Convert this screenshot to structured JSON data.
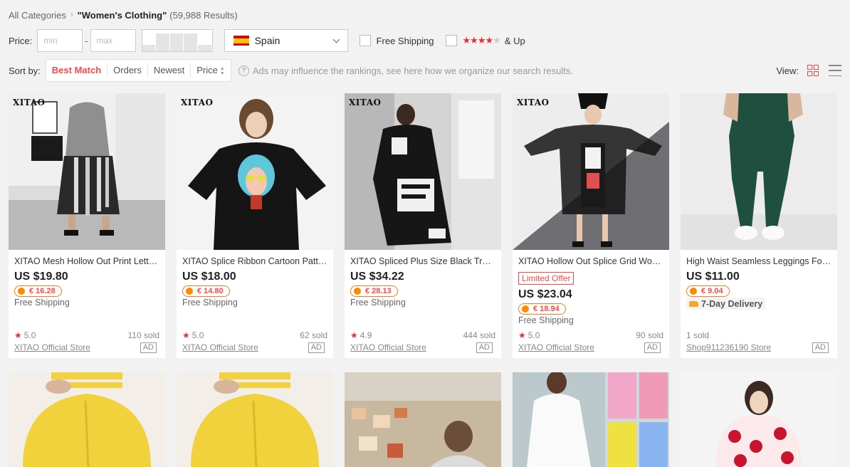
{
  "breadcrumb": {
    "root": "All Categories",
    "separator": "›",
    "query": "\"Women's Clothing\"",
    "count": "(59,988 Results)"
  },
  "filters": {
    "price_label": "Price:",
    "min_placeholder": "min",
    "max_placeholder": "max",
    "dash": "-",
    "country": "Spain",
    "free_shipping_label": "Free Shipping",
    "rating_stars": "★★★★",
    "rating_star_dim": "★",
    "rating_suffix": "& Up"
  },
  "sortbar": {
    "label": "Sort by:",
    "options": [
      "Best Match",
      "Orders",
      "Newest",
      "Price"
    ],
    "active": "Best Match",
    "ads_note": "Ads may influence the rankings, see here how we organize our search results.",
    "view_label": "View:"
  },
  "products": [
    {
      "brand": "XITAO",
      "title": "XITAO Mesh Hollow Out Print Letter Casual Dress",
      "price": "US $19.80",
      "coin_price": "€ 16.28",
      "shipping": "Free Shipping",
      "rating": "5.0",
      "sold": "110 sold",
      "store": "XITAO Official Store",
      "ad": "AD"
    },
    {
      "brand": "XITAO",
      "title": "XITAO Splice Ribbon Cartoon Pattern T-shirt Dress",
      "price": "US $18.00",
      "coin_price": "€ 14.80",
      "shipping": "Free Shipping",
      "rating": "5.0",
      "sold": "62 sold",
      "store": "XITAO Official Store",
      "ad": "AD"
    },
    {
      "brand": "XITAO",
      "title": "XITAO Spliced Plus Size Black Trench Coat",
      "price": "US $34.22",
      "coin_price": "€ 28.13",
      "shipping": "Free Shipping",
      "rating": "4.9",
      "sold": "444 sold",
      "store": "XITAO Official Store",
      "ad": "AD"
    },
    {
      "brand": "XITAO",
      "title": "XITAO Hollow Out Splice Grid Women Dress",
      "limited": "Limited Offer",
      "price": "US $23.04",
      "coin_price": "€ 18.94",
      "shipping": "Free Shipping",
      "rating": "5.0",
      "sold": "90 sold",
      "store": "XITAO Official Store",
      "ad": "AD"
    },
    {
      "title": "High Waist Seamless Leggings For Women",
      "price": "US $11.00",
      "coin_price": "€ 9.04",
      "delivery": "7-Day Delivery",
      "sold": "1 sold",
      "store": "Shop911236190 Store",
      "ad": "AD"
    }
  ],
  "colors": {
    "accent": "#ff4747",
    "coin": "#ff8a00"
  }
}
